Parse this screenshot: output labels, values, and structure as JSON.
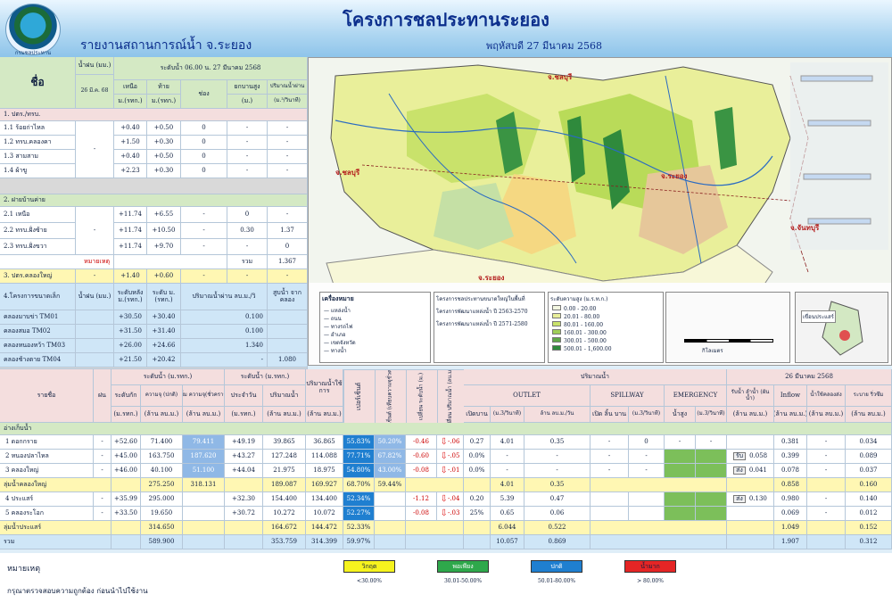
{
  "header": {
    "title": "โครงการชลประทานระยอง",
    "subtitle": "รายงานสถานการณ์น้ำ จ.ระยอง",
    "date": "พฤหัสบดี 27 มีนาคม 2568",
    "logo_caption": "กรมชลประทาน"
  },
  "left": {
    "h_name": "ชื่อ",
    "h_rain": "น้ำฝน",
    "h_rain_unit": "(มม.)",
    "h_rain_date": "26 มี.ค. 68",
    "h_level": "ระดับน้ำ 06.00 น.",
    "h_level_date": "27 มีนาคม 2568",
    "h_up": "เหนือ",
    "h_down": "ท้าย",
    "h_unit_msl": "ม.(รทก.)",
    "h_gate": "ช่อง",
    "h_lift": "ยกบานสูง",
    "h_lift_unit": "(ม.)",
    "h_flow": "ปริมาณน้ำผ่าน",
    "h_flow_unit": "(ม.³/วินาที)",
    "sec1": "1. ปตร./ทรบ.",
    "rows1": [
      [
        "1.1 ร้อยก่าไหล",
        "+0.40",
        "+0.50",
        "0",
        "-",
        "-"
      ],
      [
        "1.2 ทรบ.คลองคา",
        "+1.50",
        "+0.30",
        "0",
        "-",
        "-"
      ],
      [
        "1.3 สามสาม",
        "+0.40",
        "+0.50",
        "0",
        "-",
        "-"
      ],
      [
        "1.4 ผ้าขู",
        "+2.23",
        "+0.30",
        "0",
        "-",
        "-"
      ]
    ],
    "rows1_rain": "-",
    "sec2": "2. ฝายบ้านค่าย",
    "rows2": [
      [
        "2.1 เหนือ",
        "+11.74",
        "+6.55",
        "-",
        "0",
        "-"
      ],
      [
        "2.2 ทรบ.ฝั่งซ้าย",
        "+11.74",
        "+10.50",
        "-",
        "0.30",
        "1.37"
      ],
      [
        "2.3 ทรบ.ฝั่งขวา",
        "+11.74",
        "+9.70",
        "-",
        "-",
        "0"
      ]
    ],
    "rows2_rain": "-",
    "note_label": "หมายเหตุ",
    "sum_label": "รวม",
    "sum_value": "1.367",
    "sec3": [
      "3. ปตร.คลองใหญ่",
      "-",
      "+1.40",
      "+0.60",
      "-",
      "-",
      "-"
    ],
    "h4_name": "4.โครงการขนาดเล็ก",
    "h4_rain": "น้ำฝน",
    "h4_rain_unit": "(มม.)",
    "h4_level": "ระดับหลัง",
    "h4_level_unit": "ม.(รทก.)",
    "h4_level2": "ระดับ ม.",
    "h4_level2_unit": "(รทก.)",
    "h4_flow": "ปริมาณน้ำผ่าน ลบ.ม./วิ",
    "h4_drop": "สูบน้ำ จาก",
    "h4_drop2": "คลอง",
    "rows4": [
      [
        "คลองมาบข่า TM01",
        "+30.50",
        "+30.40",
        "0.100",
        ""
      ],
      [
        "คลองสมอ TM02",
        "+31.50",
        "+31.40",
        "0.100",
        ""
      ],
      [
        "คลองหนองหว้า TM03",
        "+26.00",
        "+24.66",
        "1.340",
        ""
      ],
      [
        "คลองช้างตาย TM04",
        "+21.50",
        "+20.42",
        "-",
        "1.080"
      ]
    ]
  },
  "map": {
    "labels": [
      "จ.ชลบุรี",
      "จ.ชลบุรี",
      "จ.ระยอง",
      "จ.จันทบุรี",
      "จ.ระยอง"
    ],
    "legend_title": "เครื่องหมาย",
    "legend_items": [
      "แหล่งน้ำ",
      "ถนน",
      "ทางรถไฟ",
      "อำเภอ",
      "เขตจังหวัด",
      "ทางน้ำ"
    ],
    "area_legend_title": "โครงการชลประทานขนาดใหญ่ในพื้นที่",
    "area_legend_items": [
      "โครงการพัฒนาแหล่งน้ำ ปี 2563-2570",
      "โครงการพัฒนาแหล่งน้ำ ปี 2571-2580"
    ],
    "elev_title": "ระดับความสูง (ม.ร.ท.ก.)",
    "elev_items": [
      "0.00 - 20.00",
      "20.01 - 80.00",
      "80.01 - 160.00",
      "160.01 - 300.00",
      "300.01 - 500.00",
      "500.01 - 1,600.00"
    ],
    "inset_label": "เขื่อนประแสร์",
    "scale_label": "กิโลเมตร"
  },
  "bottom": {
    "h_name": "รายชื่อ",
    "h_rain": "ฝน",
    "h_level": "ระดับน้ำ (ม.รทก.)",
    "h_full": "ระดับกัก",
    "h_full_unit": "(ม.รทก.)",
    "h_cap": "ความจุ (ปกติ)",
    "h_cap_unit": "(ล้าน ลบ.ม.)",
    "h_max": "เพิ่ม ความจุ(ชั่วคราว)",
    "h_max_unit": "(ล้าน ลบ.ม.)",
    "h_now": "ระดับน้ำ (ม.รทก.)",
    "h_now_date": "ประจำวัน",
    "h_now_unit": "(ม.รทก.)",
    "h_vol": "ปริมาณน้ำ",
    "h_vol_unit": "(ล้าน ลบ.ม.)",
    "h_use": "ปริมาณน้ำใช้",
    "h_use2": "การ",
    "h_use_unit": "(ล้าน ลบ.ม.)",
    "h_pct": "เปอร์เซ็นต์",
    "h_pct2": "เปอร์เซ็นต์",
    "h_pct2b": "(เทียบความจุชั่วคราว)",
    "h_chg": "เปลี่ยน ระดับน้ำ",
    "h_chg_unit": "(ม.)",
    "h_vchg": "เปลี่ยน ปริมาณน้ำ",
    "h_vchg_unit": "(ลบ.ม.)",
    "h_release": "ปริมาณน้ำ",
    "h_outlet": "OUTLET",
    "h_spill": "SPILLWAY",
    "h_emer": "EMERGENCY",
    "h_open": "เปิดบาน",
    "h_cms": "(ม.3/วินาที)",
    "h_mcm": "ล้าน ลบ.ม./วัน",
    "h_open2": "เปิด ลิ้น",
    "h_open2b": "บาน",
    "h_water": "น้ำสูง",
    "h_date": "26 มีนาคม 2568",
    "h_in": "รับน้ำ ลำน้ำ",
    "h_in2": "(ผันน้ำ)",
    "h_inflow": "Inflow",
    "h_out2": "น้ำใช้คลองส่ง",
    "h_evap": "ระบาย ริ่วซึม",
    "h_mcm2": "(ล้าน ลบ.ม.)",
    "group_a": "อ่างเก็บน้ำ",
    "rows": [
      {
        "name": "1 ดอกกราย",
        "rain": "-",
        "full": "+52.60",
        "cap": "71.400",
        "max": "79.411",
        "now": "+49.19",
        "vol": "39.865",
        "use": "36.865",
        "pct": "55.83%",
        "pct2": "50.20%",
        "chg": "-0.46",
        "vchg": "-.06",
        "open": "0.27",
        "cms": "4.01",
        "mcm": "0.35",
        "sp1": "-",
        "sp2": "0",
        "e1": "-",
        "e2": "-",
        "in": "",
        "in2": "",
        "inflow": "0.381",
        "out": "-",
        "evap": "0.034"
      },
      {
        "name": "2 หนองปลาไหล",
        "rain": "-",
        "full": "+45.00",
        "cap": "163.750",
        "max": "187.620",
        "now": "+43.27",
        "vol": "127.248",
        "use": "114.088",
        "pct": "77.71%",
        "pct2": "67.82%",
        "chg": "-0.60",
        "vchg": "-.05",
        "open": "0.0%",
        "cms": "-",
        "mcm": "-",
        "sp1": "-",
        "sp2": "-",
        "e1": "",
        "e2": "",
        "in": "รับ",
        "in2": "0.058",
        "inflow": "0.399",
        "out": "-",
        "evap": "0.089"
      },
      {
        "name": "3 คลองใหญ่",
        "rain": "-",
        "full": "+46.00",
        "cap": "40.100",
        "max": "51.100",
        "now": "+44.04",
        "vol": "21.975",
        "use": "18.975",
        "pct": "54.80%",
        "pct2": "43.00%",
        "chg": "-0.08",
        "vchg": "-.01",
        "open": "0.0%",
        "cms": "-",
        "mcm": "-",
        "sp1": "-",
        "sp2": "-",
        "e1": "",
        "e2": "",
        "in": "ส่ง",
        "in2": "0.041",
        "inflow": "0.078",
        "out": "-",
        "evap": "0.037"
      }
    ],
    "sum_a": {
      "name": "ลุ่มน้ำคลองใหญ่",
      "cap": "275.250",
      "max": "318.131",
      "vol": "189.087",
      "use": "169.927",
      "pct": "68.70%",
      "pct2": "59.44%",
      "cms": "4.01",
      "mcm": "0.35",
      "inflow": "0.858",
      "evap": "0.160"
    },
    "rows_b": [
      {
        "name": "4 ประแสร์",
        "rain": "-",
        "full": "+35.99",
        "cap": "295.000",
        "max": "",
        "now": "+32.30",
        "vol": "154.400",
        "use": "134.400",
        "pct": "52.34%",
        "pct2": "",
        "chg": "-1.12",
        "vchg": "-.04",
        "open": "0.20",
        "cms": "5.39",
        "mcm": "0.47",
        "sp1": "",
        "sp2": "",
        "e1": "",
        "e2": "",
        "in": "ส่ง",
        "in2": "0.130",
        "inflow": "0.980",
        "out": "-",
        "evap": "0.140"
      },
      {
        "name": "5 คลองระโอก",
        "rain": "-",
        "full": "+33.50",
        "cap": "19.650",
        "max": "",
        "now": "+30.72",
        "vol": "10.272",
        "use": "10.072",
        "pct": "52.27%",
        "pct2": "",
        "chg": "-0.08",
        "vchg": "-.03",
        "open": "25%",
        "cms": "0.65",
        "mcm": "0.06",
        "sp1": "",
        "sp2": "",
        "e1": "",
        "e2": "",
        "in": "",
        "in2": "",
        "inflow": "0.069",
        "out": "-",
        "evap": "0.012"
      }
    ],
    "sum_b": {
      "name": "ลุ่มน้ำประแสร์",
      "cap": "314.650",
      "vol": "164.672",
      "use": "144.472",
      "pct": "52.33%",
      "cms": "6.044",
      "mcm": "0.522",
      "inflow": "1.049",
      "evap": "0.152"
    },
    "total": {
      "name": "รวม",
      "cap": "589.900",
      "vol": "353.759",
      "use": "314.399",
      "pct": "59.97%",
      "cms": "10.057",
      "mcm": "0.869",
      "inflow": "1.907",
      "evap": "0.312"
    }
  },
  "footer": {
    "note": "หมายเหตุ",
    "check": "กรุณาตรวจสอบความถูกต้อง ก่อนนำไปใช้งาน",
    "badges": [
      {
        "label": "วิกฤต",
        "range": "<30.00%",
        "color": "#f6f31e"
      },
      {
        "label": "พอเพียง",
        "range": "30.01-50.00%",
        "color": "#2ea84b"
      },
      {
        "label": "ปกติ",
        "range": "50.01-80.00%",
        "color": "#1f7fd0"
      },
      {
        "label": "น้ำมาก",
        "range": "> 80.00%",
        "color": "#e52525"
      }
    ]
  }
}
